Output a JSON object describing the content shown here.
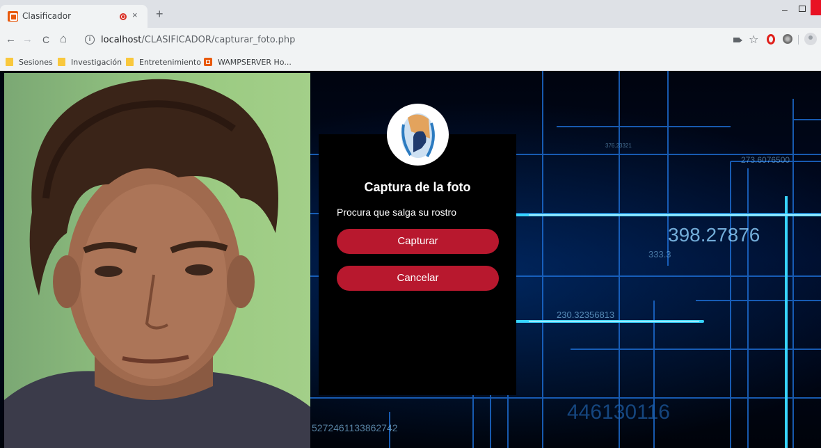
{
  "browser": {
    "tab_title": "Clasificador",
    "tab_close": "×",
    "new_tab": "+",
    "url_host": "localhost",
    "url_path": "/CLASIFICADOR/capturar_foto.php",
    "nav_back": "←",
    "nav_forward": "→",
    "nav_reload": "C",
    "nav_home": "⌂",
    "bookmarks": [
      {
        "label": "Sesiones",
        "icon": "folder-icon"
      },
      {
        "label": "Investigación",
        "icon": "folder-icon"
      },
      {
        "label": "Entretenimiento",
        "icon": "folder-icon"
      },
      {
        "label": "WAMPSERVER Ho...",
        "icon": "wampserver-icon"
      }
    ],
    "window_minimize": "–"
  },
  "background": {
    "numbers": [
      "398.27876",
      "230.32356813",
      "446130116",
      "5272461133862742",
      "333.3",
      "273.6076500",
      "376.23321"
    ]
  },
  "panel": {
    "title": "Captura de la foto",
    "hint": "Procura que salga su rostro",
    "capture_label": "Capturar",
    "cancel_label": "Cancelar",
    "button_color": "#b8182e"
  }
}
